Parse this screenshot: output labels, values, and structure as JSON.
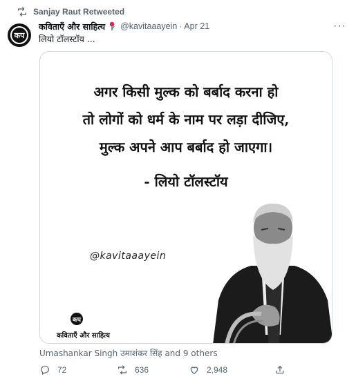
{
  "retweet": {
    "label": "Sanjay Raut Retweeted"
  },
  "tweet": {
    "display_name": "कविताएँ और साहित्य",
    "handle": "@kavitaaayein",
    "date": "Apr 21",
    "separator": "·",
    "text": "लियो टॉलस्टॉय ...",
    "more_label": "···"
  },
  "media": {
    "quote_lines": [
      "अगर किसी मुल्क को बर्बाद करना हो",
      "तो लोगों को धर्म के नाम पर लड़ा दीजिए,",
      "मुल्क अपने आप बर्बाद हो जाएगा।"
    ],
    "attribution": "- लियो टॉलस्टॉय",
    "watermark": "@kavitaaayein",
    "brand_name": "कविताएँ और साहित्य",
    "logo_glyph": "कप"
  },
  "social": {
    "liked_by": "Umashankar Singh उमाशंकर सिंह and 9 others"
  },
  "actions": {
    "replies": "72",
    "retweets": "636",
    "likes": "2,948"
  },
  "icons": [
    "retweet-icon",
    "rose-icon",
    "more-icon",
    "reply-icon",
    "like-icon",
    "share-icon"
  ]
}
